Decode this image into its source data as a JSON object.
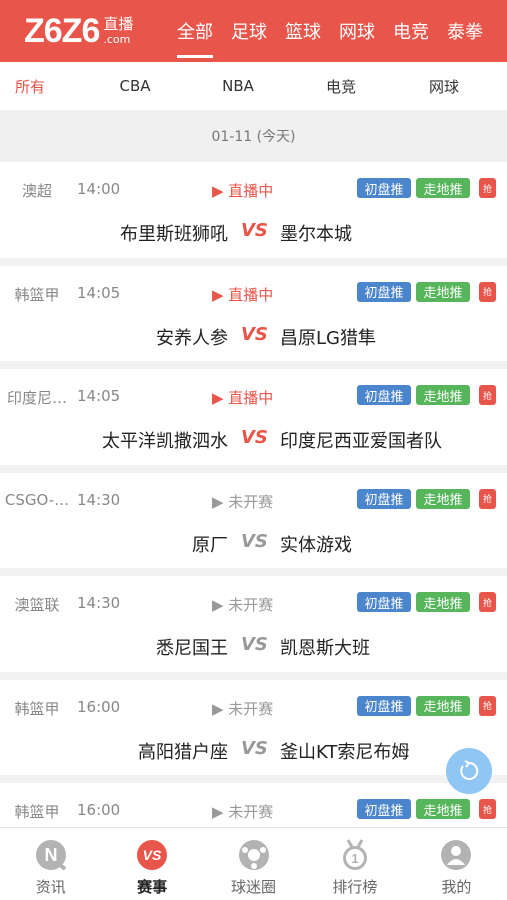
{
  "header": {
    "logo_main": "Z6Z6",
    "logo_sub_top": "直播",
    "logo_sub_bottom": ".com",
    "tabs": [
      {
        "label": "全部",
        "active": true
      },
      {
        "label": "足球",
        "active": false
      },
      {
        "label": "篮球",
        "active": false
      },
      {
        "label": "网球",
        "active": false
      },
      {
        "label": "电竞",
        "active": false
      },
      {
        "label": "泰拳",
        "active": false
      }
    ]
  },
  "subnav": {
    "items": [
      "所有",
      "CBA",
      "NBA",
      "电竞",
      "网球"
    ]
  },
  "date_label": "01-11 (今天)",
  "tags": {
    "blue": "初盘推",
    "green": "走地推",
    "red": "抢"
  },
  "matches": [
    {
      "league": "澳超",
      "time": "14:00",
      "status": "▶ 直播中",
      "status_type": "live",
      "home": "布里斯班狮吼",
      "vs": "VS",
      "away": "墨尔本城"
    },
    {
      "league": "韩篮甲",
      "time": "14:05",
      "status": "▶ 直播中",
      "status_type": "live",
      "home": "安养人参",
      "vs": "VS",
      "away": "昌原LG猎隼"
    },
    {
      "league": "印度尼…",
      "time": "14:05",
      "status": "▶ 直播中",
      "status_type": "live",
      "home": "太平洋凯撒泗水",
      "vs": "VS",
      "away": "印度尼西亚爱国者队"
    },
    {
      "league": "CSGO-…",
      "time": "14:30",
      "status": "▶ 未开赛",
      "status_type": "pending",
      "home": "原厂",
      "vs": "VS",
      "away": "实体游戏"
    },
    {
      "league": "澳篮联",
      "time": "14:30",
      "status": "▶ 未开赛",
      "status_type": "pending",
      "home": "悉尼国王",
      "vs": "VS",
      "away": "凯恩斯大班"
    },
    {
      "league": "韩篮甲",
      "time": "16:00",
      "status": "▶ 未开赛",
      "status_type": "pending",
      "home": "高阳猎户座",
      "vs": "VS",
      "away": "釜山KT索尼布姆"
    },
    {
      "league": "韩篮甲",
      "time": "16:00",
      "status": "▶ 未开赛",
      "status_type": "pending",
      "home": "",
      "vs": "",
      "away": ""
    }
  ],
  "tabbar": {
    "items": [
      {
        "label": "资讯",
        "icon": "news-icon",
        "active": false
      },
      {
        "label": "赛事",
        "icon": "vs-icon",
        "active": true
      },
      {
        "label": "球迷圈",
        "icon": "ball-icon",
        "active": false
      },
      {
        "label": "排行榜",
        "icon": "ranking-medal-icon",
        "active": false
      },
      {
        "label": "我的",
        "icon": "user-icon",
        "active": false
      }
    ]
  },
  "colors": {
    "brand": "#e8554a",
    "blue_tag": "#4b86cc",
    "green_tag": "#57b55b",
    "refresh": "#8fc6f3"
  }
}
